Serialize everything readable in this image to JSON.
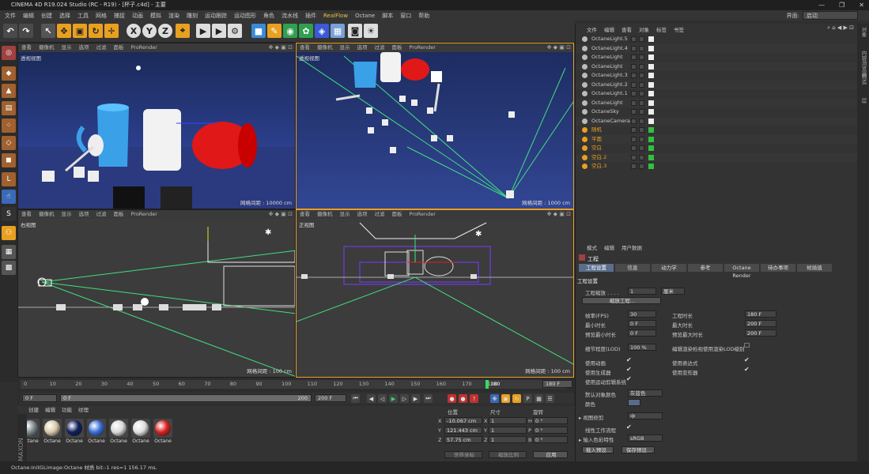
{
  "window": {
    "title": "CINEMA 4D R19.024 Studio (RC - R19) - [杯子.c4d] - 主要",
    "controls": [
      "—",
      "❐",
      "✕"
    ]
  },
  "menubar": {
    "items": [
      "文件",
      "编辑",
      "创建",
      "选择",
      "工具",
      "网格",
      "捕捉",
      "动画",
      "模拟",
      "渲染",
      "雕刻",
      "运动跟踪",
      "运动图形",
      "角色",
      "流水线",
      "插件",
      "RealFlow",
      "Octane",
      "脚本",
      "窗口",
      "帮助"
    ],
    "layout_label": "界面:",
    "layout_value": "启动"
  },
  "viewports": [
    {
      "name": "透视视图",
      "menu": [
        "查看",
        "摄像机",
        "显示",
        "选项",
        "过滤",
        "面板",
        "ProRender"
      ],
      "grid": "网格间距 : 10000 cm"
    },
    {
      "name": "透视视图",
      "menu": [
        "查看",
        "摄像机",
        "显示",
        "选项",
        "过滤",
        "面板",
        "ProRender"
      ],
      "grid": "网格间距 : 1000 cm"
    },
    {
      "name": "右视图",
      "menu": [
        "查看",
        "摄像机",
        "显示",
        "选项",
        "过滤",
        "面板",
        "ProRender"
      ],
      "grid": "网格间距 : 100 cm"
    },
    {
      "name": "正视图",
      "menu": [
        "查看",
        "摄像机",
        "显示",
        "选项",
        "过滤",
        "面板",
        "ProRender"
      ],
      "grid": "网格间距 : 100 cm"
    }
  ],
  "timeline": {
    "ticks": [
      "0",
      "10",
      "20",
      "30",
      "40",
      "50",
      "60",
      "70",
      "80",
      "90",
      "100",
      "110",
      "120",
      "130",
      "140",
      "150",
      "160",
      "170",
      "180"
    ],
    "current_frame": "0 F",
    "start": "0 F",
    "end": "200 F",
    "range_end": "200 F",
    "playhead_label": "180",
    "end_field": "180 F",
    "slider_text": "200"
  },
  "materials": {
    "tabs": [
      "创建",
      "编辑",
      "功能",
      "纹理"
    ],
    "items": [
      {
        "label": "Octane",
        "color": "#7d8a8f"
      },
      {
        "label": "Octane",
        "color": "#d8c9a8"
      },
      {
        "label": "Octane",
        "color": "#101f5c"
      },
      {
        "label": "Octane",
        "color": "#3a6ed8"
      },
      {
        "label": "Octane",
        "color": "#d8d8d8"
      },
      {
        "label": "Octane",
        "color": "#e0e0e0"
      },
      {
        "label": "Octane",
        "color": "#d82020"
      }
    ]
  },
  "coords": {
    "headers": [
      "位置",
      "尺寸",
      "旋转"
    ],
    "rows": [
      {
        "a": "X",
        "pos": "-10.067 cm",
        "b": "X",
        "size": "1",
        "c": "H",
        "rot": "0 °"
      },
      {
        "a": "Y",
        "pos": "121.443 cm",
        "b": "Y",
        "size": "1",
        "c": "P",
        "rot": "0 °"
      },
      {
        "a": "Z",
        "pos": "57.75 cm",
        "b": "Z",
        "size": "1",
        "c": "B",
        "rot": "0 °"
      }
    ],
    "mode1": "世界坐标",
    "mode2": "缩放比例",
    "apply": "应用"
  },
  "objects": {
    "tabs": [
      "文件",
      "编辑",
      "查看",
      "对象",
      "标签",
      "书签"
    ],
    "items": [
      {
        "name": "OctaneLight.5",
        "color": "#cccccc"
      },
      {
        "name": "OctaneLight.4",
        "color": "#cccccc"
      },
      {
        "name": "OctaneLight",
        "color": "#cccccc"
      },
      {
        "name": "OctaneLight",
        "color": "#cccccc"
      },
      {
        "name": "OctaneLight.3",
        "color": "#cccccc"
      },
      {
        "name": "OctaneLight.2",
        "color": "#cccccc"
      },
      {
        "name": "OctaneLight.1",
        "color": "#cccccc"
      },
      {
        "name": "OctaneLight",
        "color": "#cccccc"
      },
      {
        "name": "OctaneSky",
        "color": "#cccccc"
      },
      {
        "name": "OctaneCamera",
        "color": "#cccccc"
      },
      {
        "name": "随机",
        "color": "#e8a020"
      },
      {
        "name": "平面",
        "color": "#e8a020"
      },
      {
        "name": "空白",
        "color": "#e8a020"
      },
      {
        "name": "空白.2",
        "color": "#e8a020"
      },
      {
        "name": "空白.3",
        "color": "#e8a020"
      }
    ]
  },
  "attributes": {
    "menu": [
      "模式",
      "编辑",
      "用户数据"
    ],
    "title": "工程",
    "tabs": [
      "工程设置",
      "信息",
      "动力学",
      "参考",
      "Octane Render",
      "待办事项",
      "帧插值"
    ],
    "section": "工程设置",
    "scale_label": "工程缩放 . . . .",
    "scale_value": "1",
    "scale_unit": "厘米",
    "scale_button": "缩放工程...",
    "fps_label": "帧率(FPS)",
    "fps": "30",
    "projlen_label": "工程时长",
    "projlen": "180 F",
    "mintime_label": "最小时长",
    "mintime": "0 F",
    "maxtime_label": "最大时长",
    "maxtime": "200 F",
    "prevmin_label": "预览最小时长",
    "prevmin": "0 F",
    "prevmax_label": "预览最大时长",
    "prevmax": "200 F",
    "lod_label": "细节程度(LOD)",
    "lod": "100 %",
    "lodrender_label": "编辑渲染检视使用渲染LOD级别",
    "anim_label": "使用动画",
    "expr_label": "使用表达式",
    "gen_label": "使用生成器",
    "deform_label": "使用变形器",
    "motion_label": "使用运动剪辑系统",
    "defcolor_label": "默认对象颜色",
    "defcolor": "灰蓝色",
    "color_label": "颜色",
    "clip_label": "视图修剪",
    "clip": "中",
    "linear_label": "线性工作流程",
    "input_label": "输入色彩特性",
    "input": "sRGB",
    "load_button": "载入预设...",
    "save_button": "保存预设..."
  },
  "sidebar": [
    "对象",
    "内容浏览器",
    "构造",
    "层"
  ],
  "status": "Octane:InitGLimage:Octane 材质  bit:-1 res=1  156.17 ms."
}
